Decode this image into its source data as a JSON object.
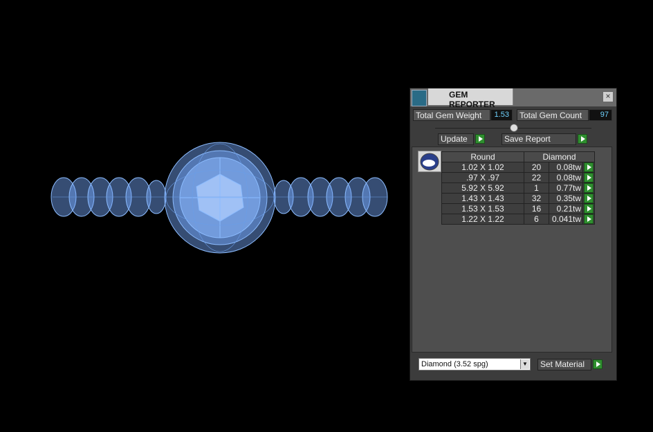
{
  "viewport": {
    "model": "ring wireframe render"
  },
  "panel": {
    "title": "GEM REPORTER",
    "total_weight_label": "Total Gem Weight",
    "total_weight_value": "1.53",
    "total_count_label": "Total Gem Count",
    "total_count_value": "97",
    "update_label": "Update",
    "save_report_label": "Save Report",
    "table": {
      "header_shape": "Round",
      "header_material": "Diamond",
      "rows": [
        {
          "size": "1.02 X 1.02",
          "count": "20",
          "weight": "0.08tw"
        },
        {
          "size": ".97 X .97",
          "count": "22",
          "weight": "0.08tw"
        },
        {
          "size": "5.92 X 5.92",
          "count": "1",
          "weight": "0.77tw"
        },
        {
          "size": "1.43 X 1.43",
          "count": "32",
          "weight": "0.35tw"
        },
        {
          "size": "1.53 X 1.53",
          "count": "16",
          "weight": "0.21tw"
        },
        {
          "size": "1.22 X 1.22",
          "count": "6",
          "weight": "0.041tw"
        }
      ]
    },
    "material_select": "Diamond     (3.52 spg)",
    "set_material_label": "Set Material"
  },
  "colors": {
    "wireframe": "#7fb2ff",
    "accent_green": "#2f8f2f",
    "value_text": "#6fd3ff"
  }
}
